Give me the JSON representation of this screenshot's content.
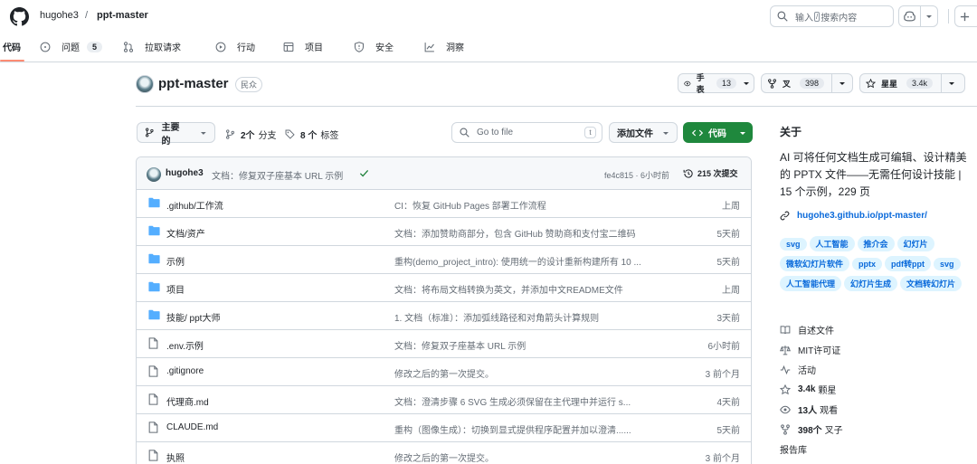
{
  "header": {
    "owner": "hugohe3",
    "separator": "/",
    "repo": "ppt-master",
    "search_text_pre": "输入",
    "search_key": "/",
    "search_text_post": "搜索内容"
  },
  "tabs": [
    {
      "label": "代码",
      "icon": "code-icon"
    },
    {
      "label": "问题",
      "icon": "issue-icon",
      "count": "5"
    },
    {
      "label": "拉取请求",
      "icon": "pull-request-icon"
    },
    {
      "label": "行动",
      "icon": "actions-play-icon"
    },
    {
      "label": "项目",
      "icon": "table-icon"
    },
    {
      "label": "安全",
      "icon": "shield-icon"
    },
    {
      "label": "洞察",
      "icon": "graph-icon"
    }
  ],
  "repo": {
    "name": "ppt-master",
    "visibility": "民众",
    "watch_label": "手表",
    "watch_count": "13",
    "fork_label": "叉",
    "fork_count": "398",
    "star_label": "星星",
    "star_count": "3.4k"
  },
  "branch_bar": {
    "branch": "主要的",
    "branches_num": "2个",
    "branches_label": "分支",
    "tags_num": "8 个",
    "tags_label": "标签",
    "goto_placeholder": "Go to file",
    "goto_key": "t",
    "add_file": "添加文件",
    "code_button": "代码"
  },
  "commit": {
    "author": "hugohe3",
    "message": "文档：修复双子座基本 URL 示例",
    "sha_time": "fe4c815 · 6小时前",
    "count": "215 次提交"
  },
  "files": [
    {
      "type": "folder",
      "name": ".github/工作流",
      "message": "CI：恢复 GitHub Pages 部署工作流程",
      "time": "上周"
    },
    {
      "type": "folder",
      "name": "文档/资产",
      "message": "文档：添加赞助商部分，包含 GitHub 赞助商和支付宝二维码",
      "time": "5天前"
    },
    {
      "type": "folder",
      "name": "示例",
      "message": "重构(demo_project_intro): 使用统一的设计重新构建所有 10 ...",
      "time": "5天前"
    },
    {
      "type": "folder",
      "name": "项目",
      "message": "文档：将布局文档转换为英文，并添加中文README文件",
      "time": "上周"
    },
    {
      "type": "folder",
      "name": "技能/ ppt大师",
      "message": "1. 文档（标准）：添加弧线路径和对角箭头计算规则",
      "time": "3天前"
    },
    {
      "type": "file",
      "name": ".env.示例",
      "message": "文档：修复双子座基本 URL 示例",
      "time": "6小时前"
    },
    {
      "type": "file",
      "name": ".gitignore",
      "message": "修改之后的第一次提交。",
      "time": "3 前个月"
    },
    {
      "type": "file",
      "name": "代理商.md",
      "message": "文档：澄清步骤 6 SVG 生成必须保留在主代理中并运行 s...",
      "time": "4天前"
    },
    {
      "type": "file",
      "name": "CLAUDE.md",
      "message": "重构（图像生成）：切换到显式提供程序配置并加以澄清......",
      "time": "5天前"
    },
    {
      "type": "file",
      "name": "执照",
      "message": "修改之后的第一次提交。",
      "time": "3 前个月"
    }
  ],
  "about": {
    "title": "关于",
    "description": "AI 可将任何文档生成可编辑、设计精美的 PPTX 文件——无需任何设计技能 | 15 个示例，229 页",
    "link": "hugohe3.github.io/ppt-master/",
    "topics": [
      "svg",
      "人工智能",
      "推介会",
      "幻灯片",
      "微软幻灯片软件",
      "pptx",
      "pdf转ppt",
      "svg",
      "人工智能代理",
      "幻灯片生成",
      "文档转幻灯片"
    ],
    "readme": "自述文件",
    "license": "MIT许可证",
    "activity": "活动",
    "stars_num": "3.4k",
    "stars_label": "颗星",
    "watch_num": "13人",
    "watch_label": "观看",
    "forks_num": "398个",
    "forks_label": "叉子",
    "reports": "报告库"
  },
  "colors": {
    "accent_green": "#1f883d",
    "link_blue": "#0969da",
    "tab_underline": "#fd8c73",
    "folder_blue": "#54aeff"
  }
}
